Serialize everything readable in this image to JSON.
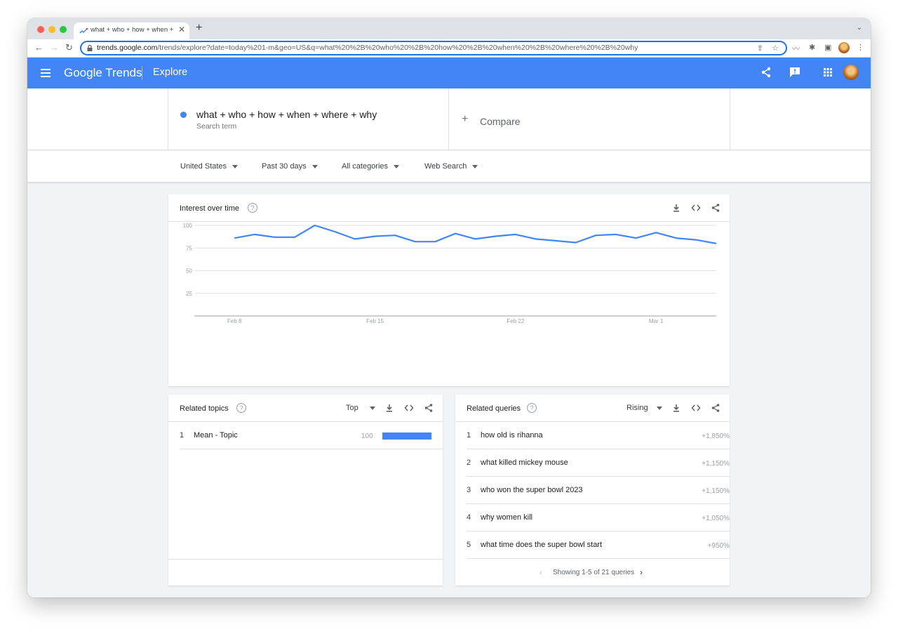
{
  "browser": {
    "tab_title": "what + who + how + when + wh",
    "url_host": "trends.google.com",
    "url_path": "/trends/explore?date=today%201-m&geo=US&q=what%20%2B%20who%20%2B%20how%20%2B%20when%20%2B%20where%20%2B%20why"
  },
  "header": {
    "logo": "Google Trends",
    "section": "Explore"
  },
  "search": {
    "term": "what + who + how + when + where + why",
    "term_sub": "Search term",
    "compare": "Compare"
  },
  "filters": {
    "region": "United States",
    "time": "Past 30 days",
    "category": "All categories",
    "source": "Web Search"
  },
  "interest": {
    "title": "Interest over time"
  },
  "chart_data": {
    "type": "line",
    "x": [
      "Feb 6",
      "Feb 7",
      "Feb 8",
      "Feb 9",
      "Feb 10",
      "Feb 11",
      "Feb 12",
      "Feb 13",
      "Feb 14",
      "Feb 15",
      "Feb 16",
      "Feb 17",
      "Feb 18",
      "Feb 19",
      "Feb 20",
      "Feb 21",
      "Feb 22",
      "Feb 23",
      "Feb 24",
      "Feb 25",
      "Feb 26",
      "Feb 27",
      "Feb 28",
      "Mar 1",
      "Mar 2",
      "Mar 3",
      "Mar 4"
    ],
    "series": [
      {
        "values": [
          86,
          90,
          87,
          87,
          100,
          93,
          85,
          88,
          89,
          82,
          82,
          91,
          85,
          88,
          90,
          85,
          83,
          81,
          89,
          90,
          86,
          92,
          86,
          84,
          80
        ]
      }
    ],
    "x_ticks": [
      "Feb 8",
      "Feb 15",
      "Feb 22",
      "Mar 1"
    ],
    "y_ticks": [
      25,
      50,
      75,
      100
    ],
    "ylim": [
      0,
      100
    ],
    "color": "#4285f4",
    "grid": true
  },
  "related_topics": {
    "title": "Related topics",
    "mode": "Top",
    "items": [
      {
        "rank": "1",
        "label": "Mean - Topic",
        "value": "100",
        "bar": 1.0
      }
    ]
  },
  "related_queries": {
    "title": "Related queries",
    "mode": "Rising",
    "items": [
      {
        "rank": "1",
        "label": "how old is rihanna",
        "value": "+1,850%"
      },
      {
        "rank": "2",
        "label": "what killed mickey mouse",
        "value": "+1,150%"
      },
      {
        "rank": "3",
        "label": "who won the super bowl 2023",
        "value": "+1,150%"
      },
      {
        "rank": "4",
        "label": "why women kill",
        "value": "+1,050%"
      },
      {
        "rank": "5",
        "label": "what time does the super bowl start",
        "value": "+950%"
      }
    ],
    "pagination": "Showing 1-5 of 21 queries"
  }
}
